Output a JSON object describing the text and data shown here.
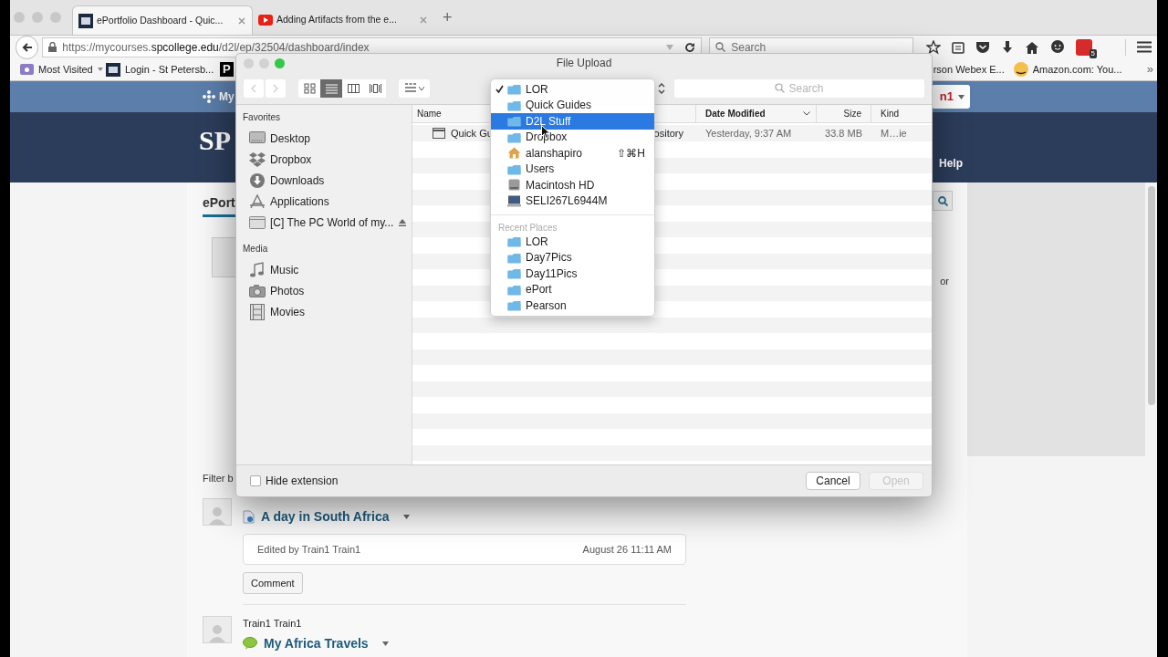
{
  "browser": {
    "tabs": [
      {
        "title": "ePortfolio Dashboard - Quic...",
        "selected": true,
        "kind": "mlc"
      },
      {
        "title": "Adding Artifacts from the e...",
        "selected": false,
        "kind": "video"
      }
    ],
    "new_tab": "+",
    "url": {
      "start": "https://mycourses.",
      "domain": "spcollege.edu",
      "end": "/d2l/ep/32504/dashboard/index"
    },
    "search_placeholder": "Search",
    "addon_badge": "5",
    "bookmarks": [
      {
        "label": "Most Visited",
        "kind": "folder"
      },
      {
        "label": "Login - St Petersb...",
        "kind": "mlc"
      },
      {
        "label": "P",
        "kind": "letter"
      }
    ],
    "bookmarks_right": [
      {
        "label": "rson Webex E...",
        "kind": "plain"
      },
      {
        "label": "Amazon.com: You...",
        "kind": "amazon"
      }
    ],
    "overflow": "»"
  },
  "page": {
    "nav_label": "My",
    "badge": "n1",
    "banner_logo": "SP",
    "help_link": "Help",
    "heading": "ePort",
    "fragment": "or",
    "filter_label": "Filter b",
    "posts": [
      {
        "title": "A day in South Africa",
        "kind": "document",
        "edited": "Edited by Train1 Train1",
        "date": "August 26 11:11 AM",
        "button": "Comment"
      },
      {
        "author": "Train1 Train1",
        "title": "My Africa Travels",
        "kind": "speech"
      }
    ]
  },
  "dialog": {
    "title": "File Upload",
    "view_modes": [
      {
        "kind": "icons",
        "selected": false
      },
      {
        "kind": "list",
        "selected": true
      },
      {
        "kind": "columns",
        "selected": false
      },
      {
        "kind": "coverflow",
        "selected": false
      }
    ],
    "search_placeholder": "Search",
    "sidebar": [
      {
        "heading": "Favorites",
        "items": [
          {
            "label": "Desktop",
            "kind": "desktop",
            "ejectable": false
          },
          {
            "label": "Dropbox",
            "kind": "dropbox",
            "ejectable": false
          },
          {
            "label": "Downloads",
            "kind": "downloads",
            "ejectable": false
          },
          {
            "label": "Applications",
            "kind": "applications",
            "ejectable": false
          },
          {
            "label": "[C] The PC World of my...",
            "kind": "folder",
            "ejectable": true
          }
        ]
      },
      {
        "heading": "Media",
        "items": [
          {
            "label": "Music",
            "kind": "music",
            "ejectable": false
          },
          {
            "label": "Photos",
            "kind": "camera",
            "ejectable": false
          },
          {
            "label": "Movies",
            "kind": "film",
            "ejectable": false
          }
        ]
      }
    ],
    "columns": [
      {
        "label": "Name",
        "sorted": false
      },
      {
        "label": "Date Modified",
        "sorted": true
      },
      {
        "label": "Size",
        "sorted": false
      },
      {
        "label": "Kind",
        "sorted": false
      }
    ],
    "files": [
      {
        "name_start": "Quick Gu",
        "name_end": "ository",
        "date": "Yesterday, 9:37 AM",
        "size": "33.8 MB",
        "kind": "M…ie"
      }
    ],
    "hide_extension": {
      "label": "Hide extension",
      "checked": false
    },
    "buttons": [
      {
        "label": "Cancel",
        "disabled": false
      },
      {
        "label": "Open",
        "disabled": true
      }
    ],
    "location_menu": {
      "items": [
        {
          "label": "LOR",
          "kind": "folder",
          "checked": true,
          "selected": false
        },
        {
          "label": "Quick Guides",
          "kind": "folder",
          "checked": false,
          "selected": false
        },
        {
          "label": "D2L Stuff",
          "kind": "folder",
          "checked": false,
          "selected": true
        },
        {
          "label": "Dropbox",
          "kind": "folder",
          "checked": false,
          "selected": false
        },
        {
          "label": "alanshapiro",
          "kind": "home",
          "checked": false,
          "selected": false,
          "shortcut": "⇧⌘H"
        },
        {
          "label": "Users",
          "kind": "folder",
          "checked": false,
          "selected": false
        },
        {
          "label": "Macintosh HD",
          "kind": "disk",
          "checked": false,
          "selected": false
        },
        {
          "label": "SELI267L6944M",
          "kind": "computer",
          "checked": false,
          "selected": false
        }
      ],
      "section": "Recent Places",
      "recent": [
        {
          "label": "LOR",
          "kind": "folder",
          "checked": false,
          "selected": false
        },
        {
          "label": "Day7Pics",
          "kind": "folder",
          "checked": false,
          "selected": false
        },
        {
          "label": "Day11Pics",
          "kind": "folder",
          "checked": false,
          "selected": false
        },
        {
          "label": "ePort",
          "kind": "folder",
          "checked": false,
          "selected": false
        },
        {
          "label": "Pearson",
          "kind": "folder",
          "checked": false,
          "selected": false
        }
      ]
    }
  }
}
